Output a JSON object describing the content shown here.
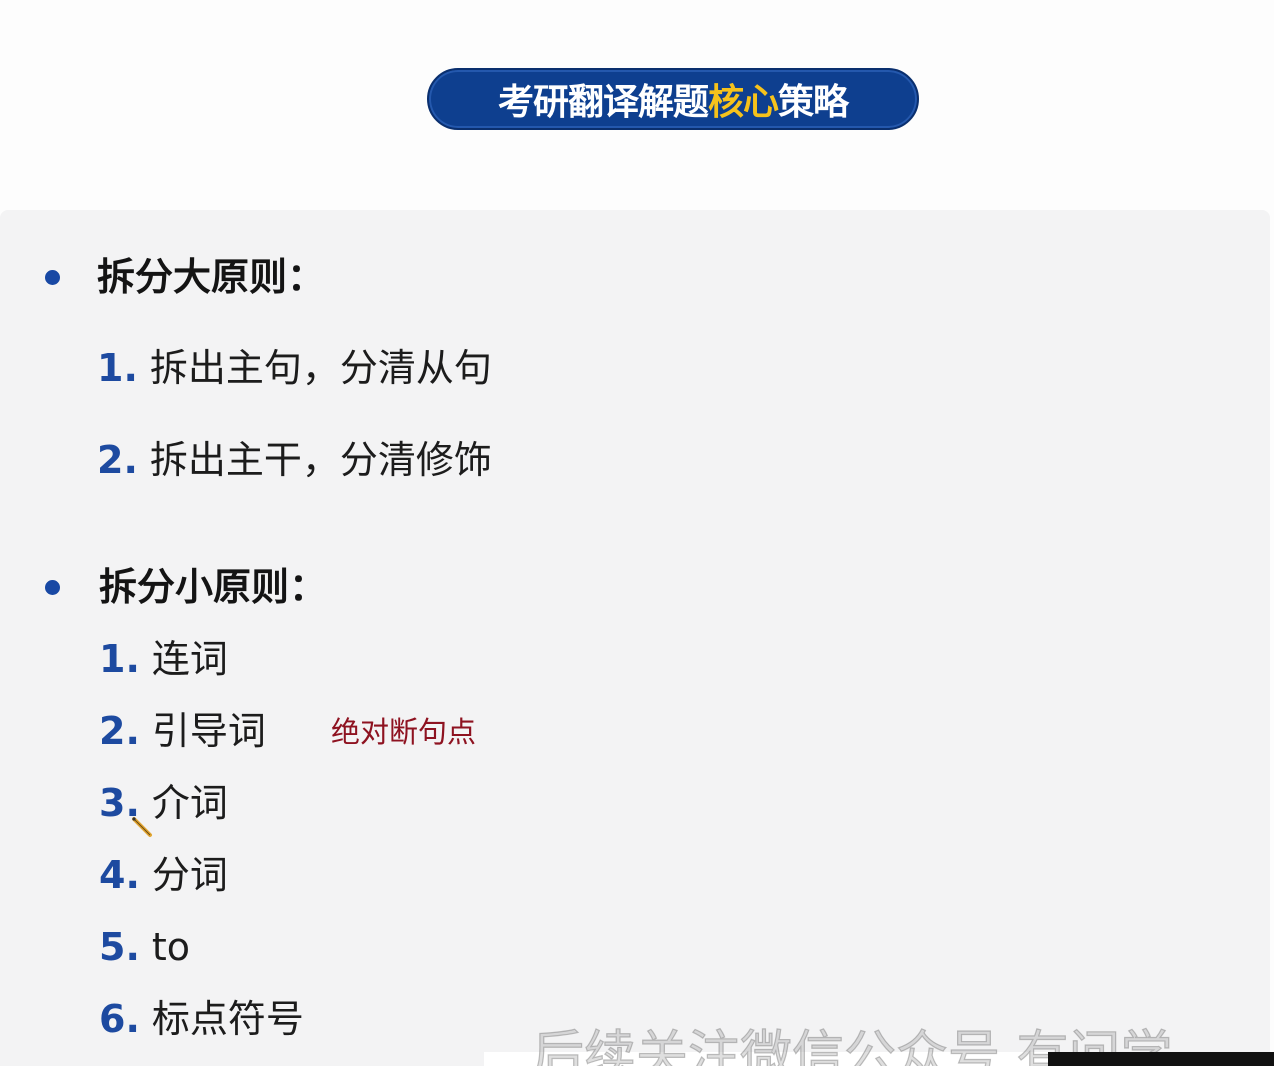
{
  "slide": {
    "title_part1": "考研翻译解题",
    "title_highlight": "核心",
    "title_part2": "策略",
    "highlight_color": "#f6c21b",
    "title_background": "#0e3f8f"
  },
  "big_principle": {
    "heading": "拆分大原则：",
    "items": [
      {
        "num": "1.",
        "text": "拆出主句，分清从句"
      },
      {
        "num": "2.",
        "text": "拆出主干，分清修饰"
      }
    ]
  },
  "small_principle": {
    "heading": "拆分小原则：",
    "items": [
      {
        "num": "1.",
        "text": "连词"
      },
      {
        "num": "2.",
        "text": "引导词"
      },
      {
        "num": "3.",
        "text": "介词"
      },
      {
        "num": "4.",
        "text": "分词"
      },
      {
        "num": "5.",
        "text": "to"
      },
      {
        "num": "6.",
        "text": "标点符号"
      }
    ],
    "annotation": "绝对断句点",
    "annotation_color": "#8e1220"
  },
  "watermark": "后续关注微信公众号 有问学"
}
